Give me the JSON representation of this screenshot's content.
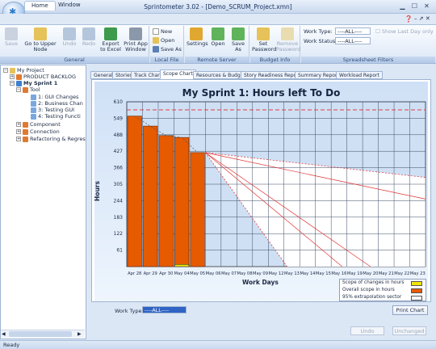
{
  "window": {
    "title": "Sprintometer 3.02 - [Demo_SCRUM_Project.xmn]"
  },
  "ribbon_tabs": [
    "Home",
    "Window"
  ],
  "ribbon": {
    "general": {
      "label": "General",
      "buttons": [
        "Save",
        "Go to Upper Node",
        "Undo",
        "Redo",
        "Export to Excel",
        "Print App Window"
      ]
    },
    "local_file": {
      "label": "Local File",
      "items": [
        "New",
        "Open",
        "Save As"
      ]
    },
    "remote_server": {
      "label": "Remote Server",
      "buttons": [
        "Settings",
        "Open",
        "Save As"
      ]
    },
    "budget_info": {
      "label": "Budget Info",
      "buttons": [
        "Set Password",
        "Remove Password"
      ]
    },
    "spreadsheet_filters": {
      "label": "Spreadsheet Filters",
      "work_type_label": "Work Type:",
      "work_type_value": "----ALL----",
      "work_status_label": "Work Status:",
      "work_status_value": "----ALL----",
      "show_last_day": "Show Last Day only"
    }
  },
  "tree": {
    "nodes": [
      {
        "label": "My Project",
        "level": 0
      },
      {
        "label": "PRODUCT BACKLOG",
        "level": 1
      },
      {
        "label": "My Sprint 1",
        "level": 1
      },
      {
        "label": "Tool",
        "level": 2
      },
      {
        "label": "1: GUI Changes",
        "level": 3
      },
      {
        "label": "2: Business Chan",
        "level": 3
      },
      {
        "label": "3: Testing GUI",
        "level": 3
      },
      {
        "label": "4: Testing Functi",
        "level": 3
      },
      {
        "label": "Component",
        "level": 2
      },
      {
        "label": "Connection",
        "level": 2
      },
      {
        "label": "Refactoring & Regres",
        "level": 2
      }
    ]
  },
  "content_tabs": [
    "General",
    "Stories",
    "Track Chart",
    "Scope Chart",
    "Resources & Budget",
    "Story Readiness Report",
    "Summary Report",
    "Workload Report"
  ],
  "active_tab": "Scope Chart",
  "chart_data": {
    "type": "bar",
    "title": "My Sprint 1: Hours left To Do",
    "xlabel": "Work Days",
    "ylabel": "Hours",
    "ylim": [
      0,
      610
    ],
    "yticks": [
      61,
      122,
      183,
      244,
      305,
      366,
      427,
      488,
      549,
      610
    ],
    "categories": [
      "Apr 28",
      "Apr 29",
      "Apr 30",
      "May 04",
      "May 05",
      "May 06",
      "May 07",
      "May 08",
      "May 09",
      "May 12",
      "May 13",
      "May 14",
      "May 15",
      "May 16",
      "May 19",
      "May 20",
      "May 21",
      "May 22",
      "May 23"
    ],
    "series": [
      {
        "name": "Overall scope in hours",
        "values": [
          557,
          520,
          485,
          478,
          422
        ]
      },
      {
        "name": "Scope of changes in hours",
        "values": [
          0,
          0,
          0,
          8,
          0
        ]
      }
    ],
    "scope_line": 580,
    "legend": [
      "Scope of changes in hours",
      "Overall scope in hours",
      "95% extrapolation sector"
    ],
    "legend_colors": [
      "#f2e600",
      "#e65a00",
      "#ffffff"
    ]
  },
  "bottom": {
    "work_type_label": "Work Type:",
    "work_type_value": "----ALL----",
    "print_chart": "Print Chart",
    "undo": "Undo",
    "unchanged": "Unchanged"
  },
  "status": "Ready"
}
